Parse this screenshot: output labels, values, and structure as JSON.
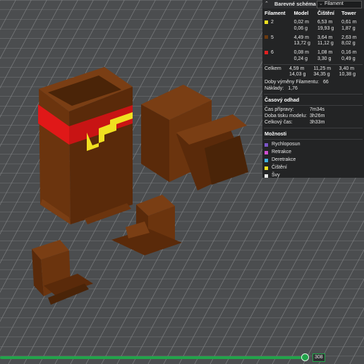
{
  "panel": {
    "title": "Barevné schéma",
    "mode_select": "Filament",
    "columns": [
      "Filament",
      "Model",
      "Čištění",
      "Tower"
    ],
    "filaments": [
      {
        "id": "2",
        "color": "#f0e020",
        "model_m": "0,02 m",
        "model_g": "0,06 g",
        "purge_m": "6,53 m",
        "purge_g": "19,93 g",
        "tower_m": "0,61 m",
        "tower_g": "1,87 g"
      },
      {
        "id": "5",
        "color": "#6b3a10",
        "model_m": "4,49 m",
        "model_g": "13,72 g",
        "purge_m": "3,64 m",
        "purge_g": "11,12 g",
        "tower_m": "2,63 m",
        "tower_g": "8,02 g"
      },
      {
        "id": "6",
        "color": "#e02020",
        "model_m": "0,08 m",
        "model_g": "0,24 g",
        "purge_m": "1,08 m",
        "purge_g": "3,30 g",
        "tower_m": "0,16 m",
        "tower_g": "0,49 g"
      }
    ],
    "total": {
      "label": "Celkem",
      "model_m": "4,59 m",
      "model_g": "14,03 g",
      "purge_m": "11,25 m",
      "purge_g": "34,35 g",
      "tower_m": "3,40 m",
      "tower_g": "10,38 g"
    },
    "changes_label": "Doby výměny Filamentu:",
    "changes_value": "66",
    "cost_label": "Náklady:",
    "cost_value": "1,76",
    "time_section": "Časový odhad",
    "prep_label": "Čas přípravy:",
    "prep_value": "7m34s",
    "print_label": "Doba tisku modelu:",
    "print_value": "3h26m",
    "total_time_label": "Celkový čas:",
    "total_time_value": "3h33m",
    "options_section": "Možnosti",
    "options": [
      {
        "label": "Rychloposun",
        "color": "#7b55c8"
      },
      {
        "label": "Retrakce",
        "color": "#d050d0"
      },
      {
        "label": "Deretrakce",
        "color": "#40b0e0"
      },
      {
        "label": "Čištění",
        "color": "#f0e020"
      },
      {
        "label": "Švy",
        "color": "#e8e8e8"
      }
    ]
  },
  "slider": {
    "value": "308",
    "fraction": 0.84
  }
}
